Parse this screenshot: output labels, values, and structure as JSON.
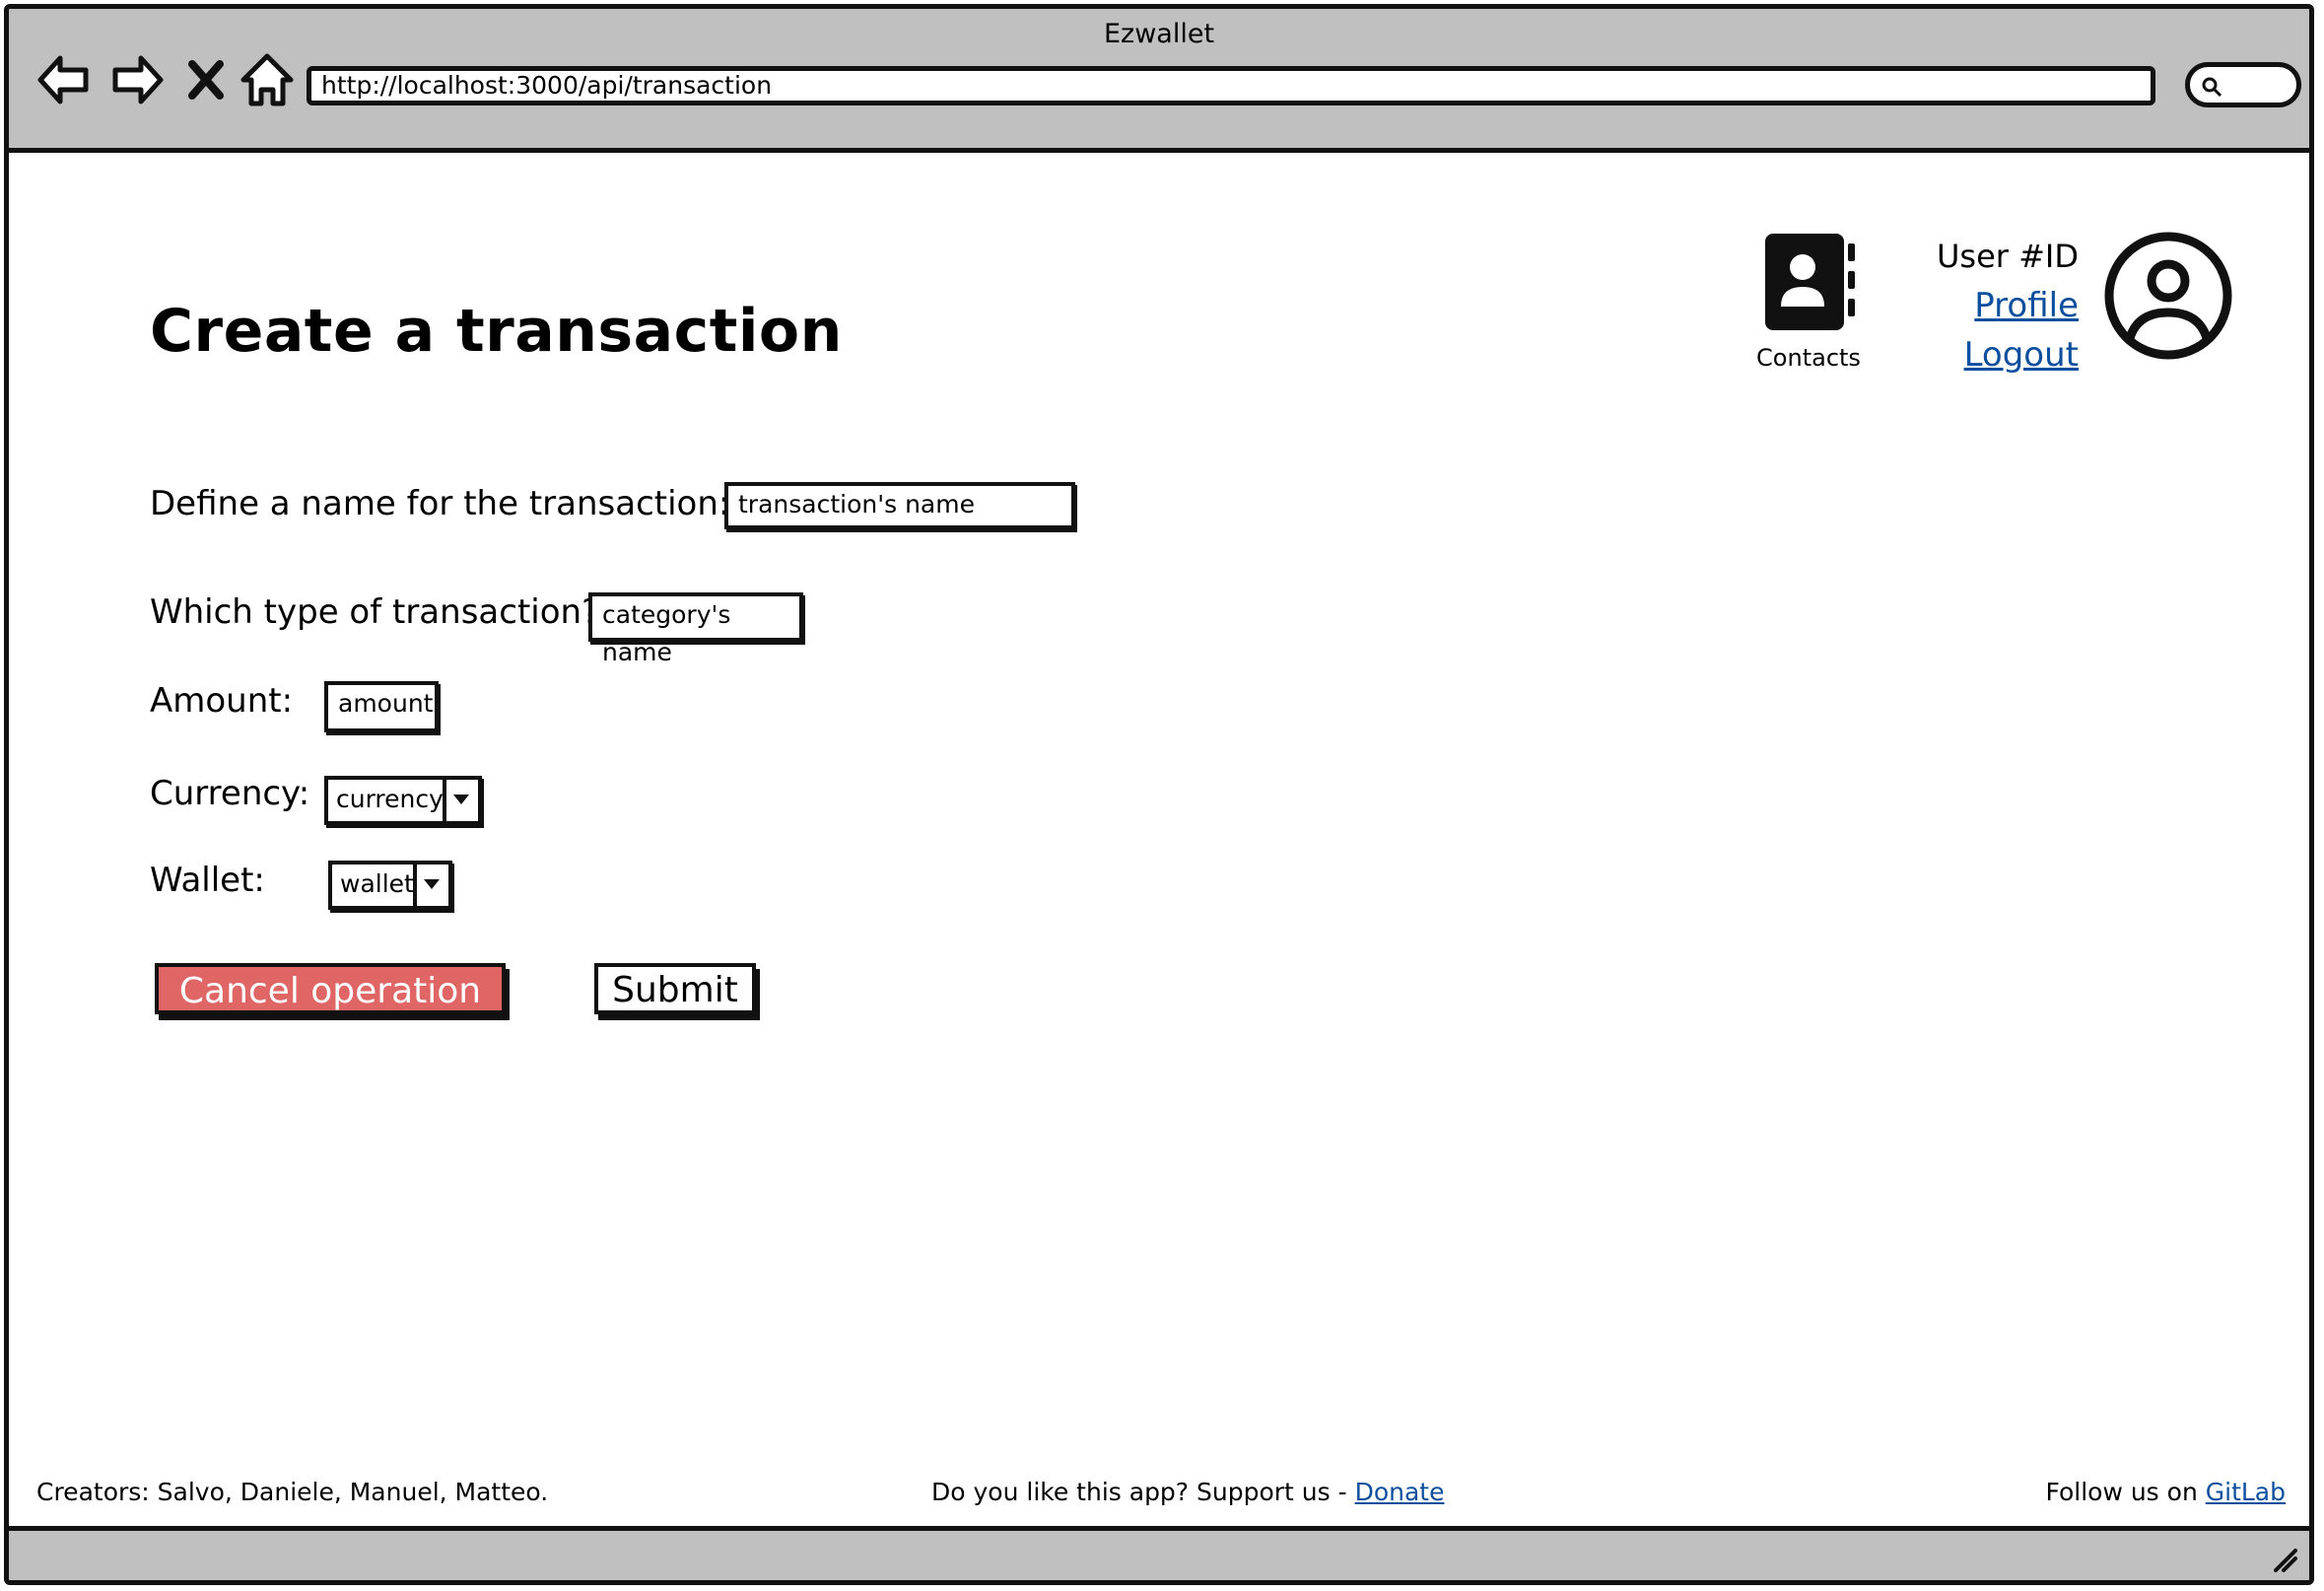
{
  "window": {
    "title": "Ezwallet"
  },
  "browser": {
    "url": "http://localhost:3000/api/transaction",
    "nav_icons": [
      "back-arrow-icon",
      "forward-arrow-icon",
      "close-x-icon",
      "home-icon"
    ]
  },
  "header": {
    "page_title": "Create a transaction",
    "contacts_label": "Contacts",
    "user_id": "User #ID",
    "profile_link": "Profile",
    "logout_link": "Logout"
  },
  "form": {
    "name": {
      "label": "Define a name for the transaction:",
      "value": "transaction's name"
    },
    "type": {
      "label": "Which type of transaction?",
      "value": "category's name"
    },
    "amount": {
      "label": "Amount:",
      "value": "amount"
    },
    "currency": {
      "label": "Currency:",
      "value": "currency"
    },
    "wallet": {
      "label": "Wallet:",
      "value": "wallet"
    }
  },
  "buttons": {
    "cancel": "Cancel operation",
    "submit": "Submit"
  },
  "footer": {
    "creators": "Creators: Salvo, Daniele, Manuel, Matteo.",
    "support_text": "Do you like this app? Support us - ",
    "donate_link": "Donate",
    "follow_text": "Follow us on ",
    "gitlab_link": "GitLab"
  },
  "colors": {
    "cancel_button": "#e06666",
    "link": "#0b4f9e",
    "chrome": "#c0c0c0"
  }
}
